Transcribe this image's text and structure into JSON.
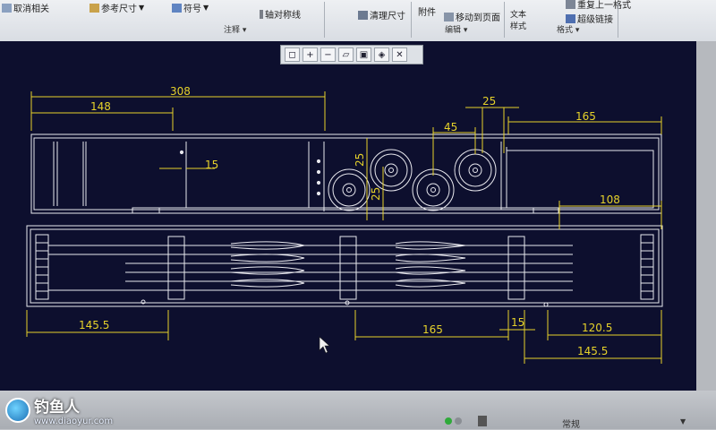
{
  "ribbon": {
    "items": [
      {
        "label": "取消相关"
      },
      {
        "label": "参考尺寸"
      },
      {
        "label": "符号"
      },
      {
        "label": "轴对称线"
      },
      {
        "label": "清理尺寸"
      },
      {
        "label": "附件"
      },
      {
        "label": "移动到页面"
      },
      {
        "label": "文本样式"
      },
      {
        "label": "超级链接"
      },
      {
        "label": "重复上一格式"
      }
    ],
    "groups": [
      {
        "label": "注释 ▾"
      },
      {
        "label": "编辑 ▾"
      },
      {
        "label": "格式 ▾"
      }
    ]
  },
  "view_toolbar": {
    "buttons": [
      {
        "icon": "zoom-fit-icon"
      },
      {
        "icon": "zoom-in-icon"
      },
      {
        "icon": "zoom-out-icon"
      },
      {
        "icon": "repaint-icon"
      },
      {
        "icon": "shade-icon"
      },
      {
        "icon": "orient-icon"
      },
      {
        "icon": "display-style-icon"
      }
    ]
  },
  "drawing": {
    "dimensions": {
      "d308": "308",
      "d148": "148",
      "d15_top": "15",
      "d25_top": "25",
      "d45": "45",
      "d165_top": "165",
      "d25_v1": "25",
      "d25_v2": "25",
      "d108": "108",
      "d145_5_left": "145.5",
      "d165_bottom": "165",
      "d15_bottom": "15",
      "d120_5": "120.5",
      "d145_5_right": "145.5"
    },
    "colors": {
      "background": "#0d0f2e",
      "geometry": "#e8e8ee",
      "dimension": "#e6d22a"
    }
  },
  "status": {
    "mode": "常规"
  },
  "watermark": {
    "brand": "钓鱼人",
    "url": "www.diaoyur.com"
  }
}
